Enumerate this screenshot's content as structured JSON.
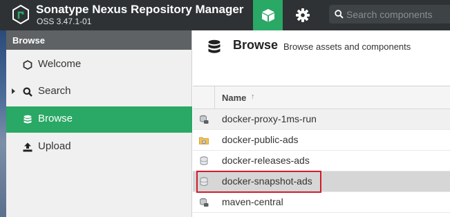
{
  "header": {
    "app_title": "Sonatype Nexus Repository Manager",
    "app_version": "OSS 3.47.1-01",
    "search_placeholder": "Search components",
    "accent_color": "#2aa865",
    "icons": {
      "logo": "nexus-logo-icon",
      "browse": "cube-icon",
      "admin": "gear-icon",
      "search": "search-icon"
    }
  },
  "sidebar": {
    "title": "Browse",
    "items": [
      {
        "label": "Welcome",
        "icon": "hexagon-icon",
        "selected": false,
        "expandable": false
      },
      {
        "label": "Search",
        "icon": "search-icon",
        "selected": false,
        "expandable": true
      },
      {
        "label": "Browse",
        "icon": "database-icon",
        "selected": true,
        "expandable": false
      },
      {
        "label": "Upload",
        "icon": "upload-icon",
        "selected": false,
        "expandable": false
      }
    ]
  },
  "main": {
    "title": "Browse",
    "subtitle": "Browse assets and components",
    "title_icon": "database-icon",
    "table": {
      "column_name": "Name",
      "sort_indicator": "↑",
      "rows": [
        {
          "name": "docker-proxy-1ms-run",
          "icon": "proxy-repo-icon",
          "selected": false
        },
        {
          "name": "docker-public-ads",
          "icon": "group-repo-icon",
          "selected": false
        },
        {
          "name": "docker-releases-ads",
          "icon": "hosted-repo-icon",
          "selected": false
        },
        {
          "name": "docker-snapshot-ads",
          "icon": "hosted-repo-icon",
          "selected": true
        },
        {
          "name": "maven-central",
          "icon": "proxy-repo-icon",
          "selected": false
        }
      ]
    }
  }
}
